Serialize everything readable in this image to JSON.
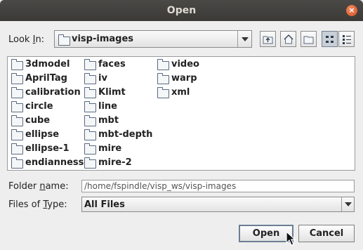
{
  "window": {
    "title": "Open",
    "close_glyph": "×"
  },
  "look_in": {
    "label_pre": "Look ",
    "label_mnemonic": "I",
    "label_post": "n:",
    "value": "visp-images"
  },
  "toolbar": {
    "buttons": [
      {
        "name": "up-one-level",
        "icon": "folder-up-icon"
      },
      {
        "name": "home",
        "icon": "home-icon"
      },
      {
        "name": "new-folder",
        "icon": "new-folder-icon"
      },
      {
        "name": "list-view",
        "icon": "list-view-icon",
        "pressed": true
      },
      {
        "name": "details-view",
        "icon": "details-view-icon",
        "pressed": false
      }
    ]
  },
  "files": {
    "columns": [
      [
        "3dmodel",
        "AprilTag",
        "calibration",
        "circle",
        "cube",
        "ellipse",
        "ellipse-1",
        "endianness"
      ],
      [
        "faces",
        "iv",
        "Klimt",
        "line",
        "mbt",
        "mbt-depth",
        "mire",
        "mire-2"
      ],
      [
        "video",
        "warp",
        "xml"
      ]
    ]
  },
  "folder_name": {
    "label_pre": "Folder ",
    "label_mnemonic": "n",
    "label_post": "ame:",
    "value": "/home/fspindle/visp_ws/visp-images"
  },
  "file_type": {
    "label_pre": "Files of ",
    "label_mnemonic": "T",
    "label_post": "ype:",
    "value": "All Files"
  },
  "buttons": {
    "open": "Open",
    "cancel": "Cancel"
  },
  "colors": {
    "titlebar": "#3c3b37",
    "close": "#e0602f",
    "accent": "#6a7f95"
  }
}
